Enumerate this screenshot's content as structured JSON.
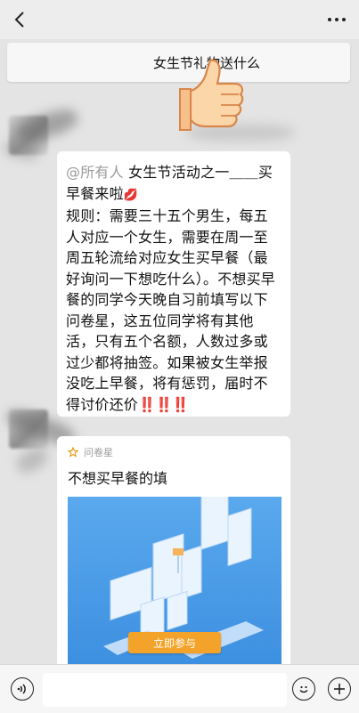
{
  "pinned": {
    "text": "女生节礼物送什么"
  },
  "message": {
    "mention": "@所有人",
    "head": "女生节活动之一＿＿买早餐来啦",
    "lips_emoji": "💋",
    "body": "规则：需要三十五个男生，每五人对应一个女生，需要在周一至周五轮流给对应女生买早餐（最好询问一下想吃什么）。不想买早餐的同学今天晚自习前填写以下问卷星，这五位同学将有其他活，只有五个名额，人数过多或过少都将抽签。如果被女生举报没吃上早餐，将有惩罚，届时不得讨价还价",
    "exclamations": "‼️‼️‼️"
  },
  "card": {
    "source": "问卷星",
    "title": "不想买早餐的填",
    "button_label": "立即参与"
  },
  "input": {
    "placeholder": ""
  },
  "colors": {
    "accent_button": "#f3a329",
    "card_image_bg": "#4a9be8"
  }
}
